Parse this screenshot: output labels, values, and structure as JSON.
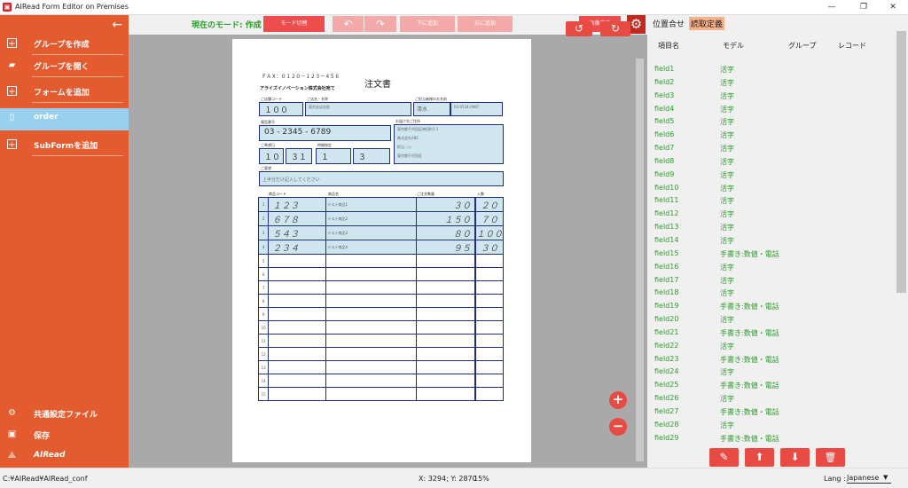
{
  "window": {
    "title": "AIRead Form Editor on Premises",
    "min": "—",
    "restore": "❐",
    "close": "✕"
  },
  "sidebar": {
    "back": "←",
    "items": [
      {
        "label": "グループを作成",
        "icon": "+"
      },
      {
        "label": "グループを開く",
        "icon": "▰"
      },
      {
        "label": "フォームを追加",
        "icon": "+"
      },
      {
        "label": "order",
        "icon": "▯"
      },
      {
        "label": "SubFormを追加",
        "icon": "+"
      }
    ],
    "bottom": [
      {
        "label": "共通設定ファイル",
        "icon": "⚙"
      },
      {
        "label": "保存",
        "icon": "▣"
      },
      {
        "label": "AIRead",
        "icon": "⟁"
      }
    ]
  },
  "toolbar": {
    "mode_text": "現在のモード: 作成",
    "mode_switch": "モード切替",
    "undo": "↶",
    "redo": "↷",
    "btn_disabled_1": "下に追加",
    "btn_disabled_2": "右に追加",
    "image_change": "画像変更",
    "rotate_left": "↺",
    "rotate_right": "↻",
    "zoom_in": "+",
    "zoom_out": "−"
  },
  "form": {
    "fax": "ＦＡＸ：０１２０－１２３－４５６",
    "title": "注文書",
    "to": "アライズイノベーション株式会社宛て",
    "caps": {
      "store_code": "ご店舗コード",
      "store_name": "ご店名・名称",
      "person": "ご担当者様のお名前",
      "phone": "電話番号",
      "address": "お届け先ご住所",
      "date": "ご希望日",
      "time": "時間指定",
      "note": "備考欄",
      "name_header": "お名前",
      "remarks": "ご要望",
      "code_h": "商品コード",
      "prod_h": "商品名",
      "qty_h": "ご注文数量",
      "unit_h": "入数"
    },
    "store_code_value": "１００",
    "store_name_value": "東京支店名前",
    "person_value": "清水",
    "person_phone": "03-0534-0987",
    "phone_value": "03 - 2345 - 6789",
    "address_l1": "東京都千代田区神田町1-1",
    "address_l2": "株式会社ABC",
    "address_l3": "担当 ○○",
    "address_l4": "東京都千代田区",
    "date_m": "１０",
    "date_d": "３１",
    "time_1": "１",
    "time_2": "３",
    "remarks_value": "上半分だけ記入してください",
    "rows": [
      {
        "n": "1",
        "code": "１２３",
        "name": "テスト商品1",
        "qty": "３０",
        "unit": "２０"
      },
      {
        "n": "2",
        "code": "６７８",
        "name": "テスト商品2",
        "qty": "１５０",
        "unit": "７０"
      },
      {
        "n": "3",
        "code": "５４３",
        "name": "テスト商品3",
        "qty": "８０",
        "unit": "１００"
      },
      {
        "n": "4",
        "code": "２３４",
        "name": "テスト商品4",
        "qty": "９５",
        "unit": "３０"
      },
      {
        "n": "5"
      },
      {
        "n": "6"
      },
      {
        "n": "7"
      },
      {
        "n": "8"
      },
      {
        "n": "9"
      },
      {
        "n": "10"
      },
      {
        "n": "11"
      },
      {
        "n": "12"
      },
      {
        "n": "13"
      },
      {
        "n": "14"
      },
      {
        "n": "15"
      }
    ]
  },
  "right_panel": {
    "tabs": [
      "位置合せ",
      "読取定義"
    ],
    "headers": [
      "項目名",
      "モデル",
      "グループ",
      "レコード"
    ],
    "fields": [
      {
        "name": "field1",
        "model": "活字"
      },
      {
        "name": "field2",
        "model": "活字"
      },
      {
        "name": "field3",
        "model": "活字"
      },
      {
        "name": "field4",
        "model": "活字"
      },
      {
        "name": "field5",
        "model": "活字"
      },
      {
        "name": "field6",
        "model": "活字"
      },
      {
        "name": "field7",
        "model": "活字"
      },
      {
        "name": "field8",
        "model": "活字"
      },
      {
        "name": "field9",
        "model": "活字"
      },
      {
        "name": "field10",
        "model": "活字"
      },
      {
        "name": "field11",
        "model": "活字"
      },
      {
        "name": "field12",
        "model": "活字"
      },
      {
        "name": "field13",
        "model": "活字"
      },
      {
        "name": "field14",
        "model": "活字"
      },
      {
        "name": "field15",
        "model": "手書き:数値・電話"
      },
      {
        "name": "field16",
        "model": "活字"
      },
      {
        "name": "field17",
        "model": "活字"
      },
      {
        "name": "field18",
        "model": "活字"
      },
      {
        "name": "field19",
        "model": "手書き:数値・電話"
      },
      {
        "name": "field20",
        "model": "活字"
      },
      {
        "name": "field21",
        "model": "手書き:数値・電話"
      },
      {
        "name": "field22",
        "model": "活字"
      },
      {
        "name": "field23",
        "model": "手書き:数値・電話"
      },
      {
        "name": "field24",
        "model": "活字"
      },
      {
        "name": "field25",
        "model": "手書き:数値・電話"
      },
      {
        "name": "field26",
        "model": "活字"
      },
      {
        "name": "field27",
        "model": "手書き:数値・電話"
      },
      {
        "name": "field28",
        "model": "活字"
      },
      {
        "name": "field29",
        "model": "手書き:数値・電話"
      }
    ],
    "actions": [
      "✎",
      "⬆",
      "⬇",
      "🗑"
    ]
  },
  "status": {
    "path": "C:¥AIRead¥AIRead_conf",
    "coords": "X: 3294; Y: 2870",
    "zoom": "15%",
    "lang_label": "Lang :",
    "lang_value": "Japanese"
  },
  "colors": {
    "sidebar": "#e35b2f",
    "accent": "#e84a44",
    "selected": "#9ad0ef",
    "mode_green": "#2a9d2a"
  }
}
